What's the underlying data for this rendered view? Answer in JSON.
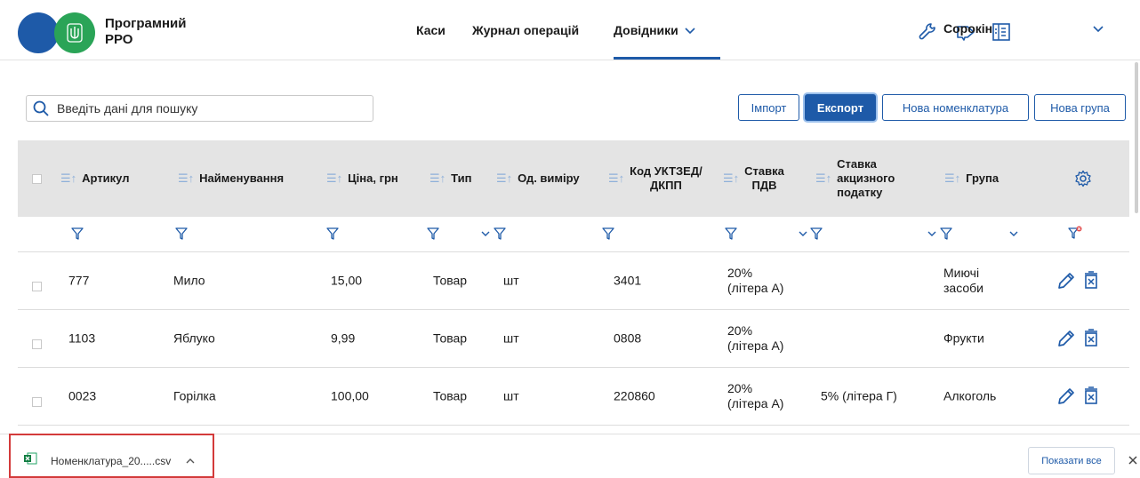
{
  "app": {
    "brand_line1": "Програмний",
    "brand_line2": "РРО"
  },
  "nav": {
    "kasy": "Каси",
    "journal": "Журнал операцій",
    "reference": "Довідники"
  },
  "user": {
    "name": "Сорокін"
  },
  "search": {
    "placeholder": "Введіть дані для пошуку"
  },
  "toolbar": {
    "import": "Імпорт",
    "export": "Експорт",
    "new_item": "Нова номенклатура",
    "new_group": "Нова група"
  },
  "table": {
    "headers": {
      "article": "Артикул",
      "name": "Найменування",
      "price": "Ціна, грн",
      "type": "Тип",
      "unit": "Од. виміру",
      "code_line1": "Код УКТЗЕД/",
      "code_line2": "ДКПП",
      "vat_line1": "Ставка",
      "vat_line2": "ПДВ",
      "excise_line1": "Ставка",
      "excise_line2": "акцизного",
      "excise_line3": "податку",
      "group": "Група"
    },
    "rows": [
      {
        "article": "777",
        "name": "Мило",
        "price": "15,00",
        "type": "Товар",
        "unit": "шт",
        "code": "3401",
        "vat_line1": "20%",
        "vat_line2": "(літера А)",
        "excise": "",
        "group_line1": "Миючі",
        "group_line2": "засоби"
      },
      {
        "article": "1103",
        "name": "Яблуко",
        "price": "9,99",
        "type": "Товар",
        "unit": "шт",
        "code": "0808",
        "vat_line1": "20%",
        "vat_line2": "(літера А)",
        "excise": "",
        "group_line1": "Фрукти",
        "group_line2": ""
      },
      {
        "article": "0023",
        "name": "Горілка",
        "price": "100,00",
        "type": "Товар",
        "unit": "шт",
        "code": "220860",
        "vat_line1": "20%",
        "vat_line2": "(літера А)",
        "excise": "5% (літера Г)",
        "group_line1": "Алкоголь",
        "group_line2": ""
      }
    ]
  },
  "download": {
    "filename": "Номенклатура_20.....csv",
    "show_all": "Показати все"
  },
  "colors": {
    "accent": "#1e5aa8",
    "brand_green": "#2aa457",
    "header_bg": "#e4e4e4",
    "highlight": "#d33a3a"
  }
}
